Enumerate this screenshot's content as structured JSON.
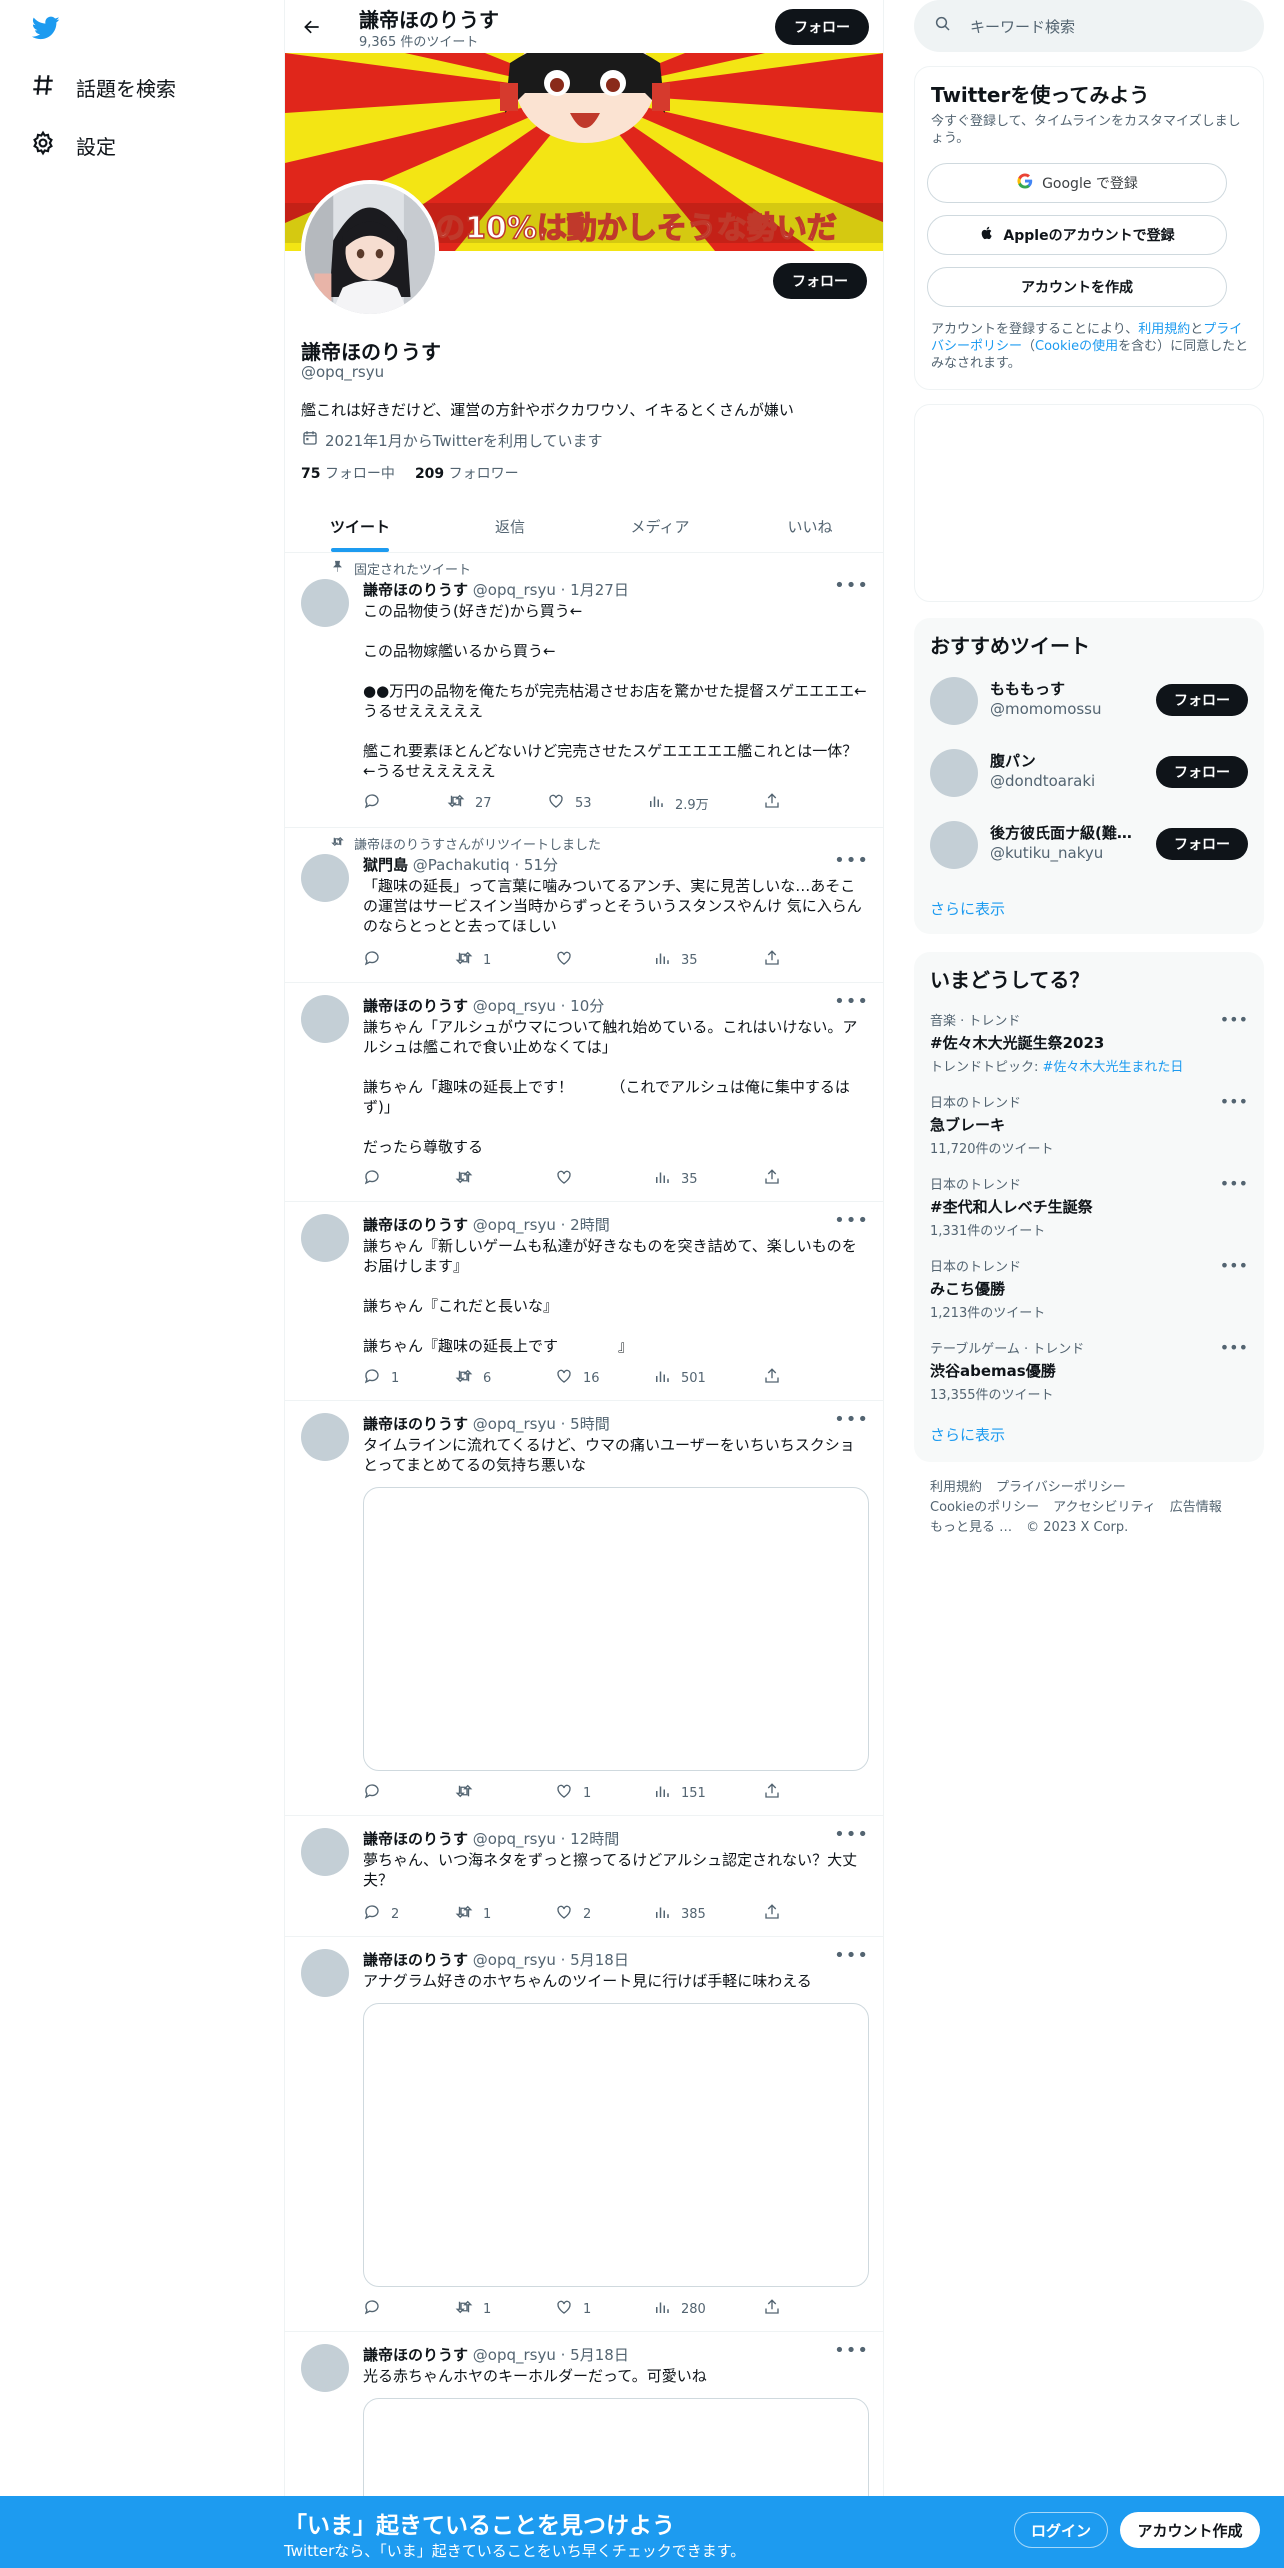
{
  "nav": {
    "explore_label": "話題を検索",
    "settings_label": "設定"
  },
  "header": {
    "name": "謙帝ほのりうす",
    "tweet_count": "9,365 件のツイート",
    "follow_label": "フォロー"
  },
  "banner": {
    "overlay_text": "の10%は動かしそうな勢いだ"
  },
  "profile": {
    "name": "謙帝ほのりうす",
    "handle": "@opq_rsyu",
    "bio": "艦これは好きだけど、運営の方針やボクカワウソ、イキるとくさんが嫌い",
    "joined": "2021年1月からTwitterを利用しています",
    "following_count": "75",
    "following_label": "フォロー中",
    "followers_count": "209",
    "followers_label": "フォロワー",
    "follow_label": "フォロー"
  },
  "tabs": [
    {
      "label": "ツイート"
    },
    {
      "label": "返信"
    },
    {
      "label": "メディア"
    },
    {
      "label": "いいね"
    }
  ],
  "tweets": [
    {
      "context": "固定されたツイート",
      "name": "謙帝ほのりうす",
      "meta": "@opq_rsyu · 1月27日",
      "text": "この品物使う(好きだ)から買う←\n\nこの品物嫁艦いるから買う←\n\n●●万円の品物を俺たちが完売枯渇させお店を驚かせた提督スゲエエエエ←うるせえええええ\n\n艦これ要素ほとんどないけど完売させたスゲエエエエエ艦これとは一体？←うるせえええええ",
      "reply": "",
      "retweet": "27",
      "like": "53",
      "views": "2.9万"
    },
    {
      "context": "謙帝ほのりうすさんがリツイートしました",
      "name": "獄門島",
      "meta": "@Pachakutiq · 51分",
      "text": "「趣味の延長」って言葉に噛みついてるアンチ、実に見苦しいな…あそこの運営はサービスイン当時からずっとそういうスタンスやんけ 気に入らんのならとっとと去ってほしい",
      "reply": "",
      "retweet": "1",
      "like": "",
      "views": "35"
    },
    {
      "name": "謙帝ほのりうす",
      "meta": "@opq_rsyu · 10分",
      "text": "謙ちゃん「アルシュがウマについて触れ始めている。これはいけない。アルシュは艦これで食い止めなくては」\n\n謙ちゃん「趣味の延長上です！　　　（これでアルシュは俺に集中するはず)」\n\nだったら尊敬する",
      "reply": "",
      "retweet": "",
      "like": "",
      "views": "35"
    },
    {
      "name": "謙帝ほのりうす",
      "meta": "@opq_rsyu · 2時間",
      "text": "謙ちゃん『新しいゲームも私達が好きなものを突き詰めて、楽しいものをお届けします』\n\n謙ちゃん『これだと長いな』\n\n謙ちゃん『趣味の延長上です　　　　』",
      "reply": "1",
      "retweet": "6",
      "like": "16",
      "views": "501"
    },
    {
      "name": "謙帝ほのりうす",
      "meta": "@opq_rsyu · 5時間",
      "text": "タイムラインに流れてくるけど、ウマの痛いユーザーをいちいちスクショとってまとめてるの気持ち悪いな",
      "reply": "",
      "retweet": "",
      "like": "1",
      "views": "151"
    },
    {
      "name": "謙帝ほのりうす",
      "meta": "@opq_rsyu · 12時間",
      "text": "夢ちゃん、いつ海ネタをずっと擦ってるけどアルシュ認定されない？大丈夫？",
      "reply": "2",
      "retweet": "1",
      "like": "2",
      "views": "385"
    },
    {
      "name": "謙帝ほのりうす",
      "meta": "@opq_rsyu · 5月18日",
      "text": "アナグラム好きのホヤちゃんのツイート見に行けば手軽に味わえる",
      "reply": "",
      "retweet": "1",
      "like": "1",
      "views": "280"
    },
    {
      "name": "謙帝ほのりうす",
      "meta": "@opq_rsyu · 5月18日",
      "text": "光る赤ちゃんホヤのキーホルダーだって。可愛いね"
    }
  ],
  "search": {
    "placeholder": "キーワード検索"
  },
  "signup_card": {
    "title": "Twitterを使ってみよう",
    "subtitle": "今すぐ登録して、タイムラインをカスタマイズしましょう。",
    "google_label": "Google で登録",
    "apple_label": "Appleのアカウントで登録",
    "create_label": "アカウントを作成",
    "legal_prefix": "アカウントを登録することにより、",
    "legal_terms": "利用規約",
    "legal_and": "と",
    "legal_privacy": "プライバシーポリシー",
    "legal_paren_open": "（",
    "legal_cookie": "Cookieの使用",
    "legal_suffix": "を含む）に同意したとみなされます。"
  },
  "recommend": {
    "title": "おすすめツイート",
    "users": [
      {
        "name": "もももっす",
        "handle": "@momomossu"
      },
      {
        "name": "腹パン",
        "handle": "@dondtoaraki"
      },
      {
        "name": "後方彼氏面ナ級(難易…",
        "handle": "@kutiku_nakyu"
      }
    ],
    "follow_label": "フォロー",
    "show_more": "さらに表示"
  },
  "trends": {
    "title": "いまどうしてる？",
    "items": [
      {
        "category": "音楽 · トレンド",
        "name": "#佐々木大光誕生祭2023",
        "sub_prefix": "トレンドトピック: ",
        "sub_link": "#佐々木大光生まれた日"
      },
      {
        "category": "日本のトレンド",
        "name": "急ブレーキ",
        "sub": "11,720件のツイート"
      },
      {
        "category": "日本のトレンド",
        "name": "#杢代和人レベチ生誕祭",
        "sub": "1,331件のツイート"
      },
      {
        "category": "日本のトレンド",
        "name": "みこち優勝",
        "sub": "1,213件のツイート"
      },
      {
        "category": "テーブルゲーム · トレンド",
        "name": "渋谷abemas優勝",
        "sub": "13,355件のツイート"
      }
    ],
    "show_more": "さらに表示"
  },
  "footer": {
    "terms": "利用規約",
    "privacy": "プライバシーポリシー",
    "cookie": "Cookieのポリシー",
    "accessibility": "アクセシビリティ",
    "ads": "広告情報",
    "more": "もっと見る …",
    "copyright": "© 2023 X Corp."
  },
  "bottom_bar": {
    "title": "「いま」起きていることを見つけよう",
    "subtitle": "Twitterなら、「いま」起きていることをいち早くチェックできます。",
    "login_label": "ログイン",
    "signup_label": "アカウント作成"
  },
  "colors": {
    "accent": "#1d9bf0",
    "text": "#0f1419",
    "muted": "#536471"
  }
}
